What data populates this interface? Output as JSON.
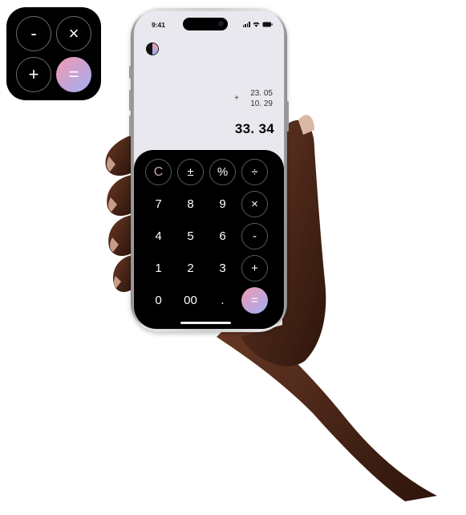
{
  "app_icon": {
    "keys": [
      {
        "id": "minus",
        "label": "-"
      },
      {
        "id": "times",
        "label": "×"
      },
      {
        "id": "plus",
        "label": "+"
      },
      {
        "id": "equals",
        "label": "="
      }
    ]
  },
  "status_bar": {
    "time": "9:41"
  },
  "display": {
    "history": {
      "operator": "+",
      "operand_1": "23. 05",
      "operand_2": "10. 29"
    },
    "result": "33. 34"
  },
  "keypad": {
    "row1": [
      "C",
      "±",
      "%",
      "÷"
    ],
    "row2": [
      "7",
      "8",
      "9",
      "×"
    ],
    "row3": [
      "4",
      "5",
      "6",
      "-"
    ],
    "row4": [
      "1",
      "2",
      "3",
      "+"
    ],
    "row5": [
      "0",
      "00",
      ".",
      "="
    ]
  },
  "colors": {
    "accent_gradient": [
      "#f39ab0",
      "#c5a3d6",
      "#9eb2f2"
    ],
    "clear_key": "#d79fc6",
    "display_bg": "#e9e8ef",
    "keypad_bg": "#000000"
  }
}
